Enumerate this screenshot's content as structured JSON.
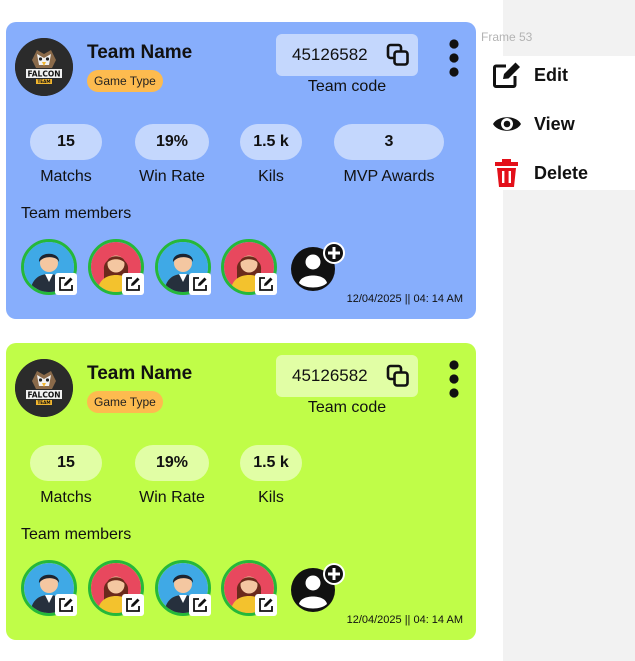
{
  "frame": {
    "label": "Frame 53"
  },
  "menu": {
    "items": [
      {
        "label": "Edit",
        "icon": "edit-icon"
      },
      {
        "label": "View",
        "icon": "eye-icon"
      },
      {
        "label": "Delete",
        "icon": "trash-icon",
        "color": "#e3101a"
      }
    ]
  },
  "cards": [
    {
      "color": "#87aefc",
      "logo_text": "FALCON",
      "logo_subtext": "TEAM",
      "team_name": "Team Name",
      "game_type": "Game Type",
      "team_code": "45126582",
      "team_code_label": "Team code",
      "stats": [
        {
          "value": "15",
          "label": "Matchs"
        },
        {
          "value": "19%",
          "label": "Win Rate"
        },
        {
          "value": "1.5 k",
          "label": "Kils"
        },
        {
          "value": "3",
          "label": "MVP Awards"
        }
      ],
      "members_label": "Team members",
      "timestamp": "12/04/2025 || 04: 14 AM"
    },
    {
      "color": "#c0fd48",
      "logo_text": "FALCON",
      "logo_subtext": "TEAM",
      "team_name": "Team Name",
      "game_type": "Game Type",
      "team_code": "45126582",
      "team_code_label": "Team code",
      "stats": [
        {
          "value": "15",
          "label": "Matchs"
        },
        {
          "value": "19%",
          "label": "Win Rate"
        },
        {
          "value": "1.5 k",
          "label": "Kils"
        }
      ],
      "members_label": "Team members",
      "timestamp": "12/04/2025 || 04: 14 AM"
    }
  ]
}
